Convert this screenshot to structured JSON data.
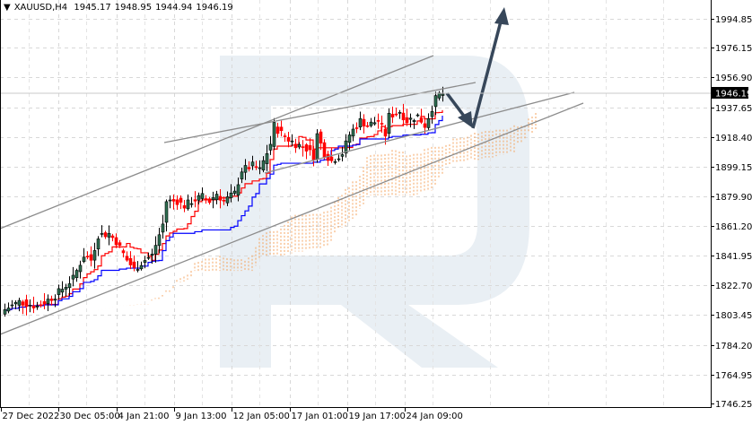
{
  "header": {
    "symbol": "XAUUSD,H4",
    "open": "1945.17",
    "high": "1948.95",
    "low": "1944.94",
    "close": "1946.19"
  },
  "colors": {
    "bull": "#2f6f52",
    "bear": "#ff0000",
    "tenkan": "#ff0000",
    "kijun": "#0000ff",
    "cloud": "#f4a460",
    "watermark": "#e9eff4",
    "grid": "#d8d8d8",
    "trend": "#8c8c8c",
    "arrow": "#37475a"
  },
  "chart_data": {
    "type": "candlestick",
    "title": "XAUUSD,H4",
    "indicators": [
      "Ichimoku Kinko Hyo"
    ],
    "ylim": [
      1746.25,
      2003
    ],
    "y_ticks": [
      "1994.85",
      "1976.15",
      "1956.90",
      "1937.65",
      "1918.40",
      "1899.15",
      "1879.90",
      "1861.20",
      "1841.95",
      "1822.70",
      "1803.45",
      "1784.20",
      "1764.95",
      "1746.25"
    ],
    "x_ticks": [
      "27 Dec 2022",
      "30 Dec 05:00",
      "4 Jan 21:00",
      "9 Jan 13:00",
      "12 Jan 05:00",
      "17 Jan 01:00",
      "19 Jan 17:00",
      "24 Jan 09:00"
    ],
    "current_price": "1946.19",
    "bars": 123,
    "price_path": [
      [
        0,
        1807
      ],
      [
        4,
        1812
      ],
      [
        9,
        1809
      ],
      [
        14,
        1816
      ],
      [
        19,
        1827
      ],
      [
        22,
        1842
      ],
      [
        24,
        1839
      ],
      [
        26,
        1855
      ],
      [
        29,
        1856
      ],
      [
        31,
        1851
      ],
      [
        34,
        1839
      ],
      [
        36,
        1833
      ],
      [
        39,
        1839
      ],
      [
        41,
        1842
      ],
      [
        44,
        1862
      ],
      [
        45,
        1877
      ],
      [
        48,
        1877
      ],
      [
        50,
        1874
      ],
      [
        52,
        1877
      ],
      [
        55,
        1880
      ],
      [
        57,
        1877
      ],
      [
        59,
        1882
      ],
      [
        61,
        1877
      ],
      [
        64,
        1882
      ],
      [
        66,
        1897
      ],
      [
        69,
        1900
      ],
      [
        71,
        1897
      ],
      [
        74,
        1914
      ],
      [
        75,
        1926
      ],
      [
        76,
        1923
      ],
      [
        79,
        1917
      ],
      [
        81,
        1914
      ],
      [
        84,
        1911
      ],
      [
        86,
        1906
      ],
      [
        87,
        1920
      ],
      [
        89,
        1908
      ],
      [
        91,
        1903
      ],
      [
        94,
        1908
      ],
      [
        96,
        1920
      ],
      [
        99,
        1929
      ],
      [
        101,
        1926
      ],
      [
        104,
        1929
      ],
      [
        106,
        1920
      ],
      [
        107,
        1932
      ],
      [
        110,
        1935
      ],
      [
        112,
        1929
      ],
      [
        115,
        1932
      ],
      [
        117,
        1926
      ],
      [
        120,
        1943
      ],
      [
        121,
        1946
      ],
      [
        122,
        1946.19
      ]
    ]
  }
}
